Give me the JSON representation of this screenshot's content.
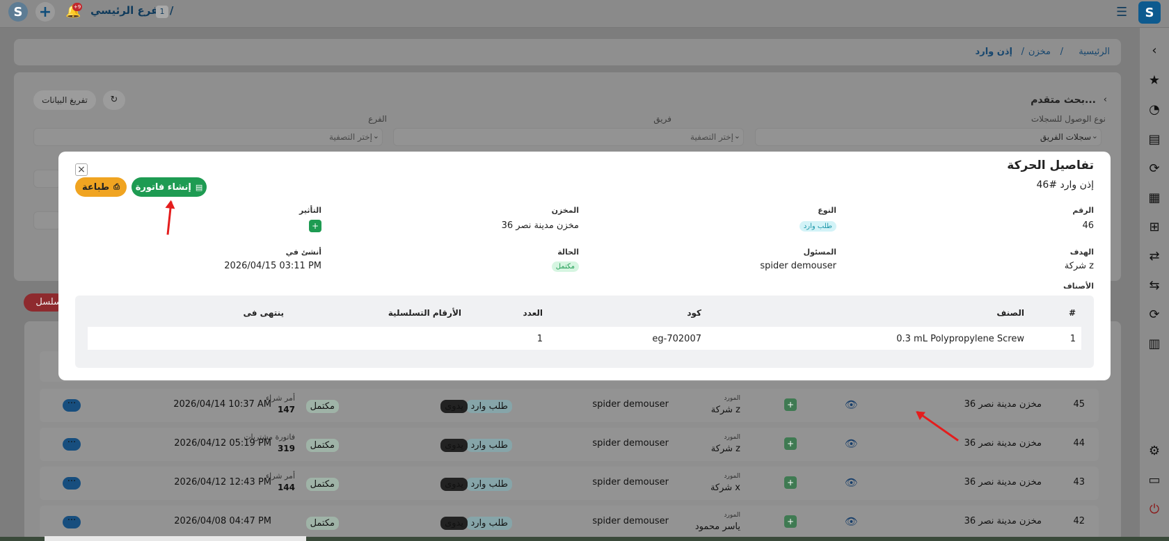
{
  "topbar": {
    "branch_count": "1",
    "branch_name": "الفرع الرئيسي /",
    "notif_count": "+9"
  },
  "breadcrumb": {
    "home": "الرئيسية",
    "stores": "مخزن",
    "current": "إذن وارد"
  },
  "filters": {
    "advanced_search": "بحث متقدم...",
    "clear_label": "تفريغ البيانات",
    "access_type_label": "نوع الوصول للسجلات",
    "access_type_value": "سجلات الفريق",
    "team_label": "فريق",
    "team_placeholder": "إختر التصفية",
    "branch_label": "الفرع",
    "branch_placeholder": "إختر التصفية",
    "serial_tab": "سلسل"
  },
  "modal": {
    "title": "تفاصيل الحركة",
    "subtitle": "إذن وارد #46",
    "create_invoice": "إنشاء فاتورة",
    "print": "طباعة",
    "fields": {
      "number_label": "الرقم",
      "number_value": "46",
      "type_label": "النوع",
      "type_value": "طلب وارد",
      "store_label": "المخزن",
      "store_value": "مخزن مدينة نصر 36",
      "effect_label": "التأثير",
      "target_label": "الهدف",
      "target_value": "شركة z",
      "responsible_label": "المسئول",
      "responsible_value": "spider demouser",
      "status_label": "الحالة",
      "status_value": "مكتمل",
      "created_label": "أنشئ في",
      "created_value": "2026/04/15 03:11 PM",
      "items_label": "الأصناف"
    },
    "table": {
      "headers": {
        "num": "#",
        "item": "الصنف",
        "code": "كود",
        "qty": "العدد",
        "serials": "الأرقام التسلسلية",
        "expires": "ينتهى فى"
      },
      "rows": [
        {
          "num": "1",
          "item": "0.3 mL Polypropylene Screw",
          "code": "eg-702007",
          "qty": "1",
          "serials": "",
          "expires": ""
        }
      ]
    }
  },
  "list_rows": [
    {
      "id": "45",
      "store": "مخزن مدينة نصر 36",
      "party_label": "المورد",
      "party": "شركة z",
      "user": "spider demouser",
      "type": "طلب وارد",
      "manual": "يدوى",
      "status": "مكتمل",
      "doc_label": "أمر شراء",
      "doc_no": "147",
      "date": "2026/04/14 10:37 AM"
    },
    {
      "id": "44",
      "store": "مخزن مدينة نصر 36",
      "party_label": "المورد",
      "party": "شركة z",
      "user": "spider demouser",
      "type": "طلب وارد",
      "manual": "يدوى",
      "status": "مكتمل",
      "doc_label": "فاتورة مشتريات",
      "doc_no": "319",
      "date": "2026/04/12 05:19 PM"
    },
    {
      "id": "43",
      "store": "مخزن مدينة نصر 36",
      "party_label": "المورد",
      "party": "شركة x",
      "user": "spider demouser",
      "type": "طلب وارد",
      "manual": "يدوى",
      "status": "مكتمل",
      "doc_label": "أمر شراء",
      "doc_no": "144",
      "date": "2026/04/12 12:43 PM"
    },
    {
      "id": "42",
      "store": "مخزن مدينة نصر 36",
      "party_label": "المورد",
      "party": "ياسر محمود",
      "user": "spider demouser",
      "type": "طلب وارد",
      "manual": "يدوى",
      "status": "مكتمل",
      "doc_label": "",
      "doc_no": "",
      "date": "2026/04/08 04:47 PM"
    }
  ],
  "colors": {
    "brand": "#0d5a8f",
    "green": "#1e9b52",
    "orange": "#f0a421",
    "annotation": "#e41d1d"
  },
  "icons": [
    "logo-icon",
    "plus-icon",
    "bell-icon",
    "menu-icon",
    "chevron-left-icon",
    "star-icon",
    "gauge-icon",
    "invoice-icon",
    "refresh-icon",
    "receipt-icon",
    "box-icon",
    "transfer-icon",
    "settings-icon",
    "window-icon",
    "power-icon",
    "close-icon",
    "print-icon",
    "eye-icon",
    "box-plus-icon"
  ]
}
